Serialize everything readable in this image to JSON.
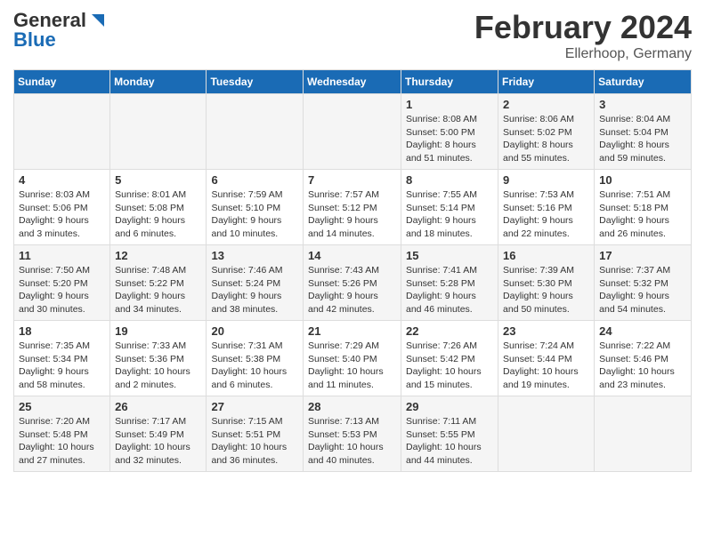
{
  "header": {
    "logo_line1": "General",
    "logo_line2": "Blue",
    "main_title": "February 2024",
    "subtitle": "Ellerhoop, Germany"
  },
  "days_of_week": [
    "Sunday",
    "Monday",
    "Tuesday",
    "Wednesday",
    "Thursday",
    "Friday",
    "Saturday"
  ],
  "weeks": [
    [
      {
        "day": "",
        "info": ""
      },
      {
        "day": "",
        "info": ""
      },
      {
        "day": "",
        "info": ""
      },
      {
        "day": "",
        "info": ""
      },
      {
        "day": "1",
        "info": "Sunrise: 8:08 AM\nSunset: 5:00 PM\nDaylight: 8 hours\nand 51 minutes."
      },
      {
        "day": "2",
        "info": "Sunrise: 8:06 AM\nSunset: 5:02 PM\nDaylight: 8 hours\nand 55 minutes."
      },
      {
        "day": "3",
        "info": "Sunrise: 8:04 AM\nSunset: 5:04 PM\nDaylight: 8 hours\nand 59 minutes."
      }
    ],
    [
      {
        "day": "4",
        "info": "Sunrise: 8:03 AM\nSunset: 5:06 PM\nDaylight: 9 hours\nand 3 minutes."
      },
      {
        "day": "5",
        "info": "Sunrise: 8:01 AM\nSunset: 5:08 PM\nDaylight: 9 hours\nand 6 minutes."
      },
      {
        "day": "6",
        "info": "Sunrise: 7:59 AM\nSunset: 5:10 PM\nDaylight: 9 hours\nand 10 minutes."
      },
      {
        "day": "7",
        "info": "Sunrise: 7:57 AM\nSunset: 5:12 PM\nDaylight: 9 hours\nand 14 minutes."
      },
      {
        "day": "8",
        "info": "Sunrise: 7:55 AM\nSunset: 5:14 PM\nDaylight: 9 hours\nand 18 minutes."
      },
      {
        "day": "9",
        "info": "Sunrise: 7:53 AM\nSunset: 5:16 PM\nDaylight: 9 hours\nand 22 minutes."
      },
      {
        "day": "10",
        "info": "Sunrise: 7:51 AM\nSunset: 5:18 PM\nDaylight: 9 hours\nand 26 minutes."
      }
    ],
    [
      {
        "day": "11",
        "info": "Sunrise: 7:50 AM\nSunset: 5:20 PM\nDaylight: 9 hours\nand 30 minutes."
      },
      {
        "day": "12",
        "info": "Sunrise: 7:48 AM\nSunset: 5:22 PM\nDaylight: 9 hours\nand 34 minutes."
      },
      {
        "day": "13",
        "info": "Sunrise: 7:46 AM\nSunset: 5:24 PM\nDaylight: 9 hours\nand 38 minutes."
      },
      {
        "day": "14",
        "info": "Sunrise: 7:43 AM\nSunset: 5:26 PM\nDaylight: 9 hours\nand 42 minutes."
      },
      {
        "day": "15",
        "info": "Sunrise: 7:41 AM\nSunset: 5:28 PM\nDaylight: 9 hours\nand 46 minutes."
      },
      {
        "day": "16",
        "info": "Sunrise: 7:39 AM\nSunset: 5:30 PM\nDaylight: 9 hours\nand 50 minutes."
      },
      {
        "day": "17",
        "info": "Sunrise: 7:37 AM\nSunset: 5:32 PM\nDaylight: 9 hours\nand 54 minutes."
      }
    ],
    [
      {
        "day": "18",
        "info": "Sunrise: 7:35 AM\nSunset: 5:34 PM\nDaylight: 9 hours\nand 58 minutes."
      },
      {
        "day": "19",
        "info": "Sunrise: 7:33 AM\nSunset: 5:36 PM\nDaylight: 10 hours\nand 2 minutes."
      },
      {
        "day": "20",
        "info": "Sunrise: 7:31 AM\nSunset: 5:38 PM\nDaylight: 10 hours\nand 6 minutes."
      },
      {
        "day": "21",
        "info": "Sunrise: 7:29 AM\nSunset: 5:40 PM\nDaylight: 10 hours\nand 11 minutes."
      },
      {
        "day": "22",
        "info": "Sunrise: 7:26 AM\nSunset: 5:42 PM\nDaylight: 10 hours\nand 15 minutes."
      },
      {
        "day": "23",
        "info": "Sunrise: 7:24 AM\nSunset: 5:44 PM\nDaylight: 10 hours\nand 19 minutes."
      },
      {
        "day": "24",
        "info": "Sunrise: 7:22 AM\nSunset: 5:46 PM\nDaylight: 10 hours\nand 23 minutes."
      }
    ],
    [
      {
        "day": "25",
        "info": "Sunrise: 7:20 AM\nSunset: 5:48 PM\nDaylight: 10 hours\nand 27 minutes."
      },
      {
        "day": "26",
        "info": "Sunrise: 7:17 AM\nSunset: 5:49 PM\nDaylight: 10 hours\nand 32 minutes."
      },
      {
        "day": "27",
        "info": "Sunrise: 7:15 AM\nSunset: 5:51 PM\nDaylight: 10 hours\nand 36 minutes."
      },
      {
        "day": "28",
        "info": "Sunrise: 7:13 AM\nSunset: 5:53 PM\nDaylight: 10 hours\nand 40 minutes."
      },
      {
        "day": "29",
        "info": "Sunrise: 7:11 AM\nSunset: 5:55 PM\nDaylight: 10 hours\nand 44 minutes."
      },
      {
        "day": "",
        "info": ""
      },
      {
        "day": "",
        "info": ""
      }
    ]
  ]
}
